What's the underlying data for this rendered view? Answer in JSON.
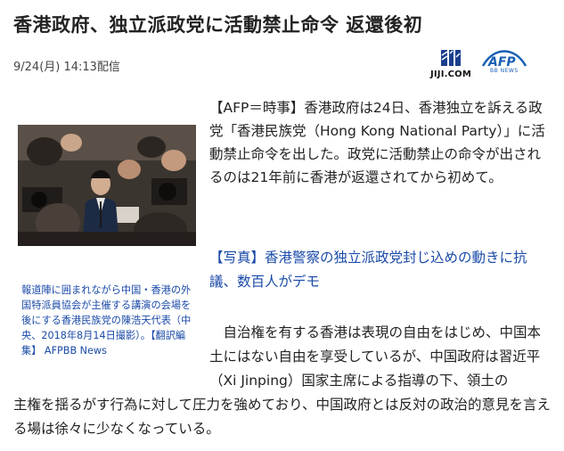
{
  "article": {
    "headline": "香港政府、独立派政党に活動禁止命令 返還後初",
    "dateline": "9/24(月) 14:13配信",
    "lead": "【AFP＝時事】香港政府は24日、香港独立を訴える政党「香港民族党（Hong Kong National Party）」に活動禁止命令を出した。政党に活動禁止の命令が出されるのは21年前に香港が返還されてから初めて。",
    "related_link": "【写真】香港警察の独立派政党封じ込めの動きに抗議、数百人がデモ",
    "paragraph2_top": "　自治権を有する香港は表現の自由をはじめ、中国本土にはない自由を享受しているが、中国政府は習近平（Xi Jinping）国家主席による指導の下、領土の",
    "paragraph2_bottom": "主権を揺るがす行為に対して圧力を強めており、中国政府とは反対の政治的意見を言える場は徐々に少なくなっている。"
  },
  "photo": {
    "caption": "報道陣に囲まれながら中国・香港の外国特派員協会が主催する講演の会場を後にする香港民族党の陳浩天代表（中央、2018年8月14日撮影）。【翻訳編集】 AFPBB News"
  },
  "sources": {
    "jiji_label": "JIJI.COM",
    "afp_label": "AFP",
    "afp_sublabel": "BB NEWS",
    "jiji_color": "#1b3f8f",
    "afp_color": "#1a5fb4"
  }
}
